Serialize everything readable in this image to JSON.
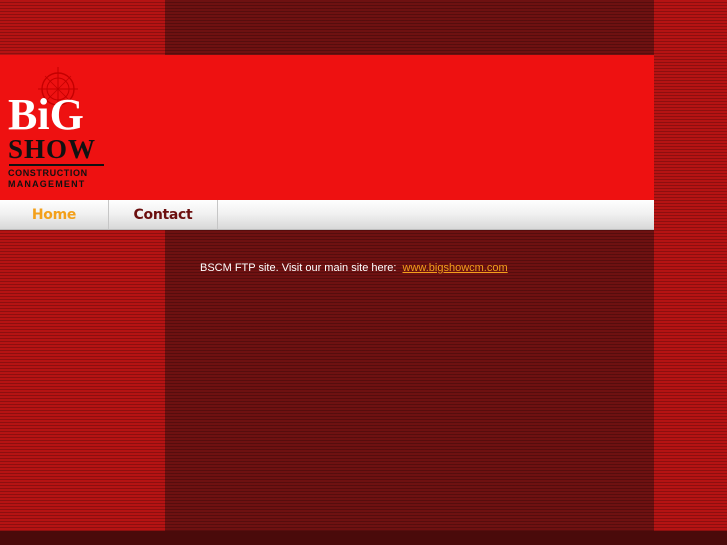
{
  "logo": {
    "word1": "BiG",
    "word2": "SHOW",
    "line1": "CONSTRUCTION",
    "line2": "MANAGEMENT"
  },
  "nav": {
    "items": [
      {
        "label": "Home",
        "color": "#f3a01b"
      },
      {
        "label": "Contact",
        "color": "#6b0f0f"
      }
    ]
  },
  "main": {
    "intro_text": "BSCM FTP site.  Visit our main site here:",
    "link_text": "www.bigshowcm.com"
  },
  "colors": {
    "header_red": "#ee1111",
    "dark_maroon": "#6e1111",
    "accent_orange": "#f3a01b"
  }
}
